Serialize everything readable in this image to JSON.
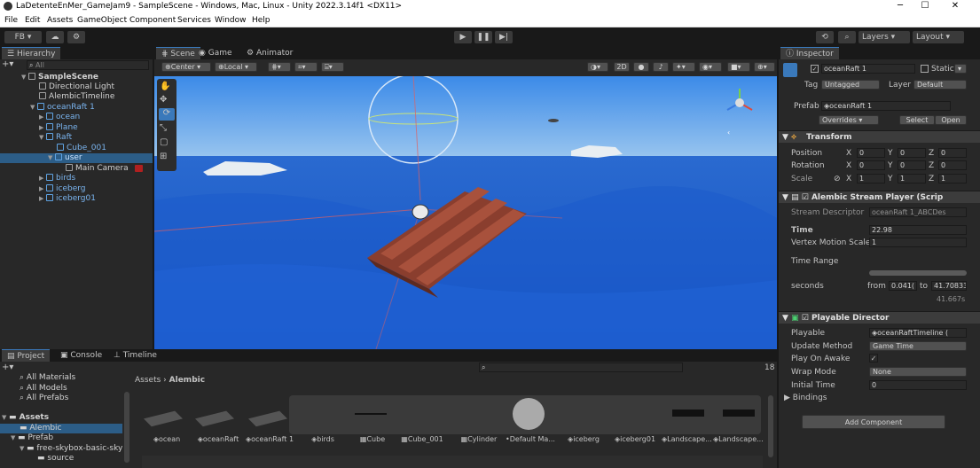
{
  "window": {
    "title": "LaDetenteEnMer_GameJam9 - SampleScene - Windows, Mac, Linux - Unity 2022.3.14f1 <DX11>",
    "minimize": "─",
    "maximize": "☐",
    "close": "✕"
  },
  "menu": [
    "File",
    "Edit",
    "Assets",
    "GameObject",
    "Component",
    "Services",
    "Window",
    "Help"
  ],
  "toolbar": {
    "account": "FB ▾",
    "layers": "Layers",
    "layout": "Layout"
  },
  "hierarchy": {
    "tab": "Hierarchy",
    "search_placeholder": "All",
    "rows": [
      {
        "label": "SampleScene",
        "depth": 0
      },
      {
        "label": "Directional Light",
        "depth": 1
      },
      {
        "label": "AlembicTimeline",
        "depth": 1
      },
      {
        "label": "oceanRaft 1",
        "depth": 1
      },
      {
        "label": "ocean",
        "depth": 2
      },
      {
        "label": "Plane",
        "depth": 2
      },
      {
        "label": "Raft",
        "depth": 2
      },
      {
        "label": "Cube_001",
        "depth": 3
      },
      {
        "label": "user",
        "depth": 3
      },
      {
        "label": "Main Camera",
        "depth": 4
      },
      {
        "label": "birds",
        "depth": 2
      },
      {
        "label": "iceberg",
        "depth": 2
      },
      {
        "label": "iceberg01",
        "depth": 2
      }
    ]
  },
  "scene": {
    "tabs": [
      "Scene",
      "Game",
      "Animator"
    ],
    "pivot": "Center",
    "space": "Local",
    "mode_2d": "2D"
  },
  "inspector": {
    "tab": "Inspector",
    "object_name": "oceanRaft 1",
    "static": "Static",
    "tag_label": "Tag",
    "tag": "Untagged",
    "layer_label": "Layer",
    "layer": "Default",
    "prefab_label": "Prefab",
    "prefab": "oceanRaft 1",
    "overrides": "Overrides",
    "select": "Select",
    "open": "Open",
    "transform": {
      "title": "Transform",
      "position_label": "Position",
      "position": [
        "0",
        "0",
        "0"
      ],
      "rotation_label": "Rotation",
      "rotation": [
        "0",
        "0",
        "0"
      ],
      "scale_label": "Scale",
      "scale": [
        "1",
        "1",
        "1"
      ],
      "x": "X",
      "y": "Y",
      "z": "Z"
    },
    "alembic": {
      "title": "Alembic Stream Player (Scrip",
      "stream_descriptor_label": "Stream Descriptor",
      "stream_descriptor": "oceanRaft 1_ABCDes",
      "time_label": "Time",
      "time": "22.98",
      "vertex_motion_label": "Vertex Motion Scale",
      "vertex_motion": "1",
      "time_range_label": "Time Range",
      "seconds_label": "seconds",
      "from_label": "from",
      "from": "0.041(",
      "to_label": "to",
      "to": "41.70833",
      "duration": "41.667s"
    },
    "director": {
      "title": "Playable Director",
      "playable_label": "Playable",
      "playable": "oceanRaftTimeline (",
      "update_label": "Update Method",
      "update": "Game Time",
      "awake_label": "Play On Awake",
      "awake": "✓",
      "wrap_label": "Wrap Mode",
      "wrap": "None",
      "initial_label": "Initial Time",
      "initial": "0",
      "bindings": "Bindings"
    },
    "add_component": "Add Component"
  },
  "project": {
    "tabs": [
      "Project",
      "Console",
      "Timeline"
    ],
    "favorites": [
      "All Materials",
      "All Models",
      "All Prefabs"
    ],
    "assets_root": "Assets",
    "folders": [
      "Alembic",
      "Prefab",
      "free-skybox-basic-sky",
      "source"
    ],
    "breadcrumb_root": "Assets",
    "breadcrumb_sep": "›",
    "breadcrumb_leaf": "Alembic",
    "count": "18",
    "items": [
      "ocean",
      "oceanRaft",
      "oceanRaft 1",
      "birds",
      "Cube",
      "Cube_001",
      "Cylinder",
      "Default Ma...",
      "iceberg",
      "iceberg01",
      "Landscape...",
      "Landscape..."
    ]
  },
  "colors": {
    "accent": "#3a79bb",
    "selection": "#2c5d87",
    "panel": "#282828",
    "sky": "#5aa8e8",
    "sea": "#1e5fc8"
  }
}
